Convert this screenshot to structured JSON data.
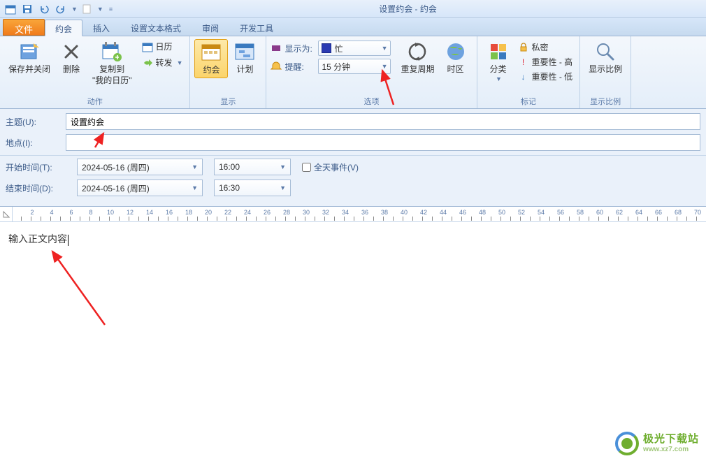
{
  "window": {
    "title": "设置约会 - 约会"
  },
  "qat": {
    "items": [
      {
        "name": "calendar-icon"
      },
      {
        "name": "save-icon"
      },
      {
        "name": "undo-icon"
      },
      {
        "name": "redo-icon"
      },
      {
        "name": "blank-icon"
      },
      {
        "name": "customize-icon"
      }
    ]
  },
  "tabs": {
    "file": "文件",
    "items": [
      {
        "label": "约会",
        "active": true
      },
      {
        "label": "插入",
        "active": false
      },
      {
        "label": "设置文本格式",
        "active": false
      },
      {
        "label": "审阅",
        "active": false
      },
      {
        "label": "开发工具",
        "active": false
      }
    ]
  },
  "ribbon": {
    "groups": {
      "actions": {
        "label": "动作",
        "save_close": "保存并关闭",
        "delete": "删除",
        "copy_to": "复制到\n\"我的日历\"",
        "calendar": "日历",
        "forward": "转发"
      },
      "show": {
        "label": "显示",
        "appointment": "约会",
        "plan": "计划"
      },
      "options": {
        "label": "选项",
        "show_as": "显示为:",
        "show_as_value": "忙",
        "reminder": "提醒:",
        "reminder_value": "15 分钟",
        "recurrence": "重复周期",
        "timezone": "时区"
      },
      "tags": {
        "label": "标记",
        "categorize": "分类",
        "private": "私密",
        "importance_high": "重要性 - 高",
        "importance_low": "重要性 - 低"
      },
      "zoom": {
        "label": "显示比例",
        "show_ratio": "显示比例"
      }
    }
  },
  "form": {
    "subject_label": "主题(U):",
    "subject_value": "设置约会",
    "location_label": "地点(I):",
    "location_value": "",
    "start_label": "开始时间(T):",
    "start_date": "2024-05-16 (周四)",
    "start_time": "16:00",
    "allday_label": "全天事件(V)",
    "end_label": "结束时间(D):",
    "end_date": "2024-05-16 (周四)",
    "end_time": "16:30"
  },
  "editor": {
    "body_text": "输入正文内容"
  },
  "watermark": {
    "cn": "极光下载站",
    "en": "www.xz7.com"
  }
}
